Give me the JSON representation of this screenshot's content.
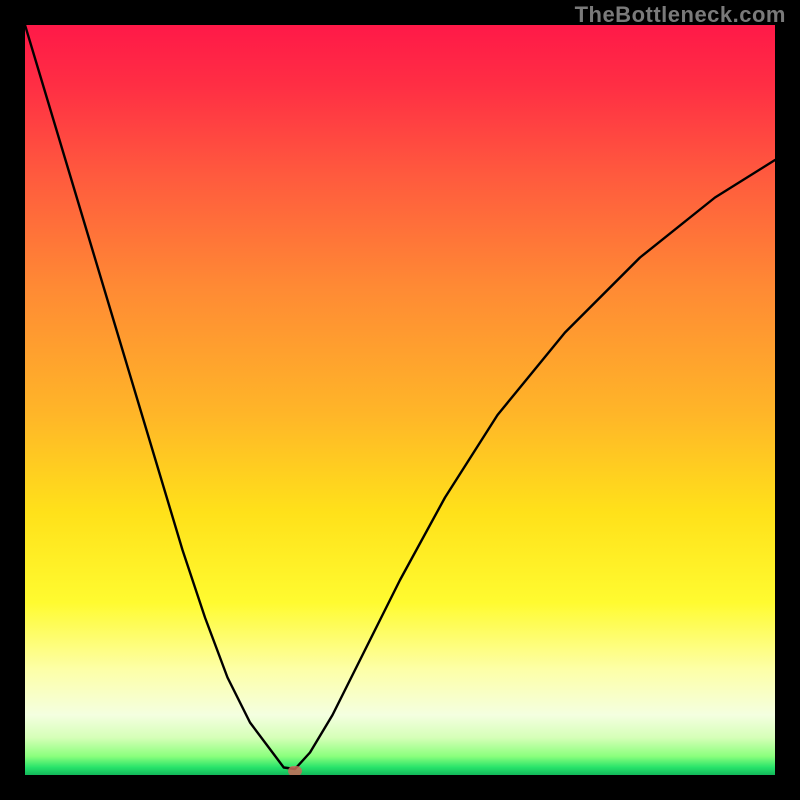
{
  "watermark": "TheBottleneck.com",
  "chart_data": {
    "type": "line",
    "title": "",
    "xlabel": "",
    "ylabel": "",
    "xlim": [
      0,
      100
    ],
    "ylim": [
      0,
      100
    ],
    "grid": false,
    "legend": false,
    "background": {
      "type": "vertical-gradient",
      "stops": [
        {
          "pct": 0,
          "color": "#ff1948"
        },
        {
          "pct": 35,
          "color": "#ff8a34"
        },
        {
          "pct": 65,
          "color": "#ffe11a"
        },
        {
          "pct": 92,
          "color": "#f4ffe0"
        },
        {
          "pct": 100,
          "color": "#12b85a"
        }
      ]
    },
    "series": [
      {
        "name": "bottleneck-curve",
        "x": [
          0,
          3,
          6,
          9,
          12,
          15,
          18,
          21,
          24,
          27,
          30,
          33,
          34.5,
          36,
          38,
          41,
          45,
          50,
          56,
          63,
          72,
          82,
          92,
          100
        ],
        "y": [
          100,
          90,
          80,
          70,
          60,
          50,
          40,
          30,
          21,
          13,
          7,
          3,
          1,
          0.8,
          3,
          8,
          16,
          26,
          37,
          48,
          59,
          69,
          77,
          82
        ]
      }
    ],
    "marker": {
      "x": 36,
      "y": 0.5,
      "color": "#c96a5a"
    }
  }
}
